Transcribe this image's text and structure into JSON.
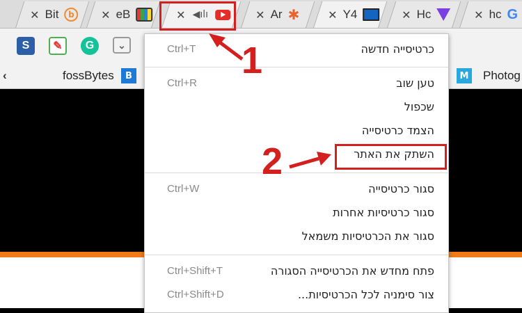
{
  "tabs": [
    {
      "label": "Bit",
      "favicon": "b-icon"
    },
    {
      "label": "eB",
      "favicon": "tv-icon"
    },
    {
      "label": "",
      "favicon": "youtube-icon",
      "audio": "speaker-icon"
    },
    {
      "label": "Ar",
      "favicon": "joomla-icon"
    },
    {
      "label": "Y4",
      "favicon": "monitor-icon"
    },
    {
      "label": "Hc",
      "favicon": "triangle-icon"
    },
    {
      "label": "hc",
      "favicon": "google-icon"
    }
  ],
  "bookmarks": {
    "fossbytes": "fossBytes",
    "photo": "Photog",
    "left_arrow": "‹"
  },
  "menu": {
    "items": [
      {
        "label": "כרטיסייה חדשה",
        "shortcut": "Ctrl+T"
      },
      {
        "label": "טען שוב",
        "shortcut": "Ctrl+R"
      },
      {
        "label": "שכפול",
        "shortcut": ""
      },
      {
        "label": "הצמד כרטיסייה",
        "shortcut": ""
      },
      {
        "label": "השתק את האתר",
        "shortcut": ""
      },
      {
        "label": "סגור כרטיסייה",
        "shortcut": "Ctrl+W"
      },
      {
        "label": "סגור כרטיסיות אחרות",
        "shortcut": ""
      },
      {
        "label": "סגור את הכרטיסיות משמאל",
        "shortcut": ""
      },
      {
        "label": "פתח מחדש את הכרטיסייה הסגורה",
        "shortcut": "Ctrl+Shift+T"
      },
      {
        "label": "צור סימניה לכל הכרטיסיות...",
        "shortcut": "Ctrl+Shift+D"
      }
    ]
  },
  "annotations": {
    "step1": "1",
    "step2": "2"
  },
  "colors": {
    "annotation_red": "#d41f1f",
    "accent_orange": "#f07b18"
  }
}
